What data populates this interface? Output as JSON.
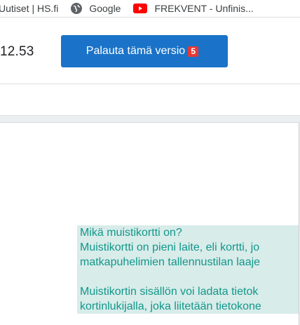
{
  "bookmarks": {
    "items": [
      {
        "label": "Uutiset | HS.fi",
        "icon": "none"
      },
      {
        "label": "Google",
        "icon": "globe-icon"
      },
      {
        "label": "FREKVENT - Unfinis...",
        "icon": "youtube-icon"
      }
    ]
  },
  "version": {
    "time_text": "12.53",
    "restore_label": "Palauta tämä versio",
    "badge": "5"
  },
  "document": {
    "lines": [
      "Mikä muistikortti on?",
      "Muistikortti on pieni laite, eli kortti, jo",
      "matkapuhelimien tallennustilan laaje",
      "",
      "Muistikortin sisällön voi ladata tietok",
      "kortinlukijalla, joka liitetään tietokone"
    ]
  },
  "colors": {
    "accent": "#1a73c8",
    "badge": "#e53935",
    "highlight_text": "#12978a",
    "highlight_bg": "#d8ecea"
  }
}
